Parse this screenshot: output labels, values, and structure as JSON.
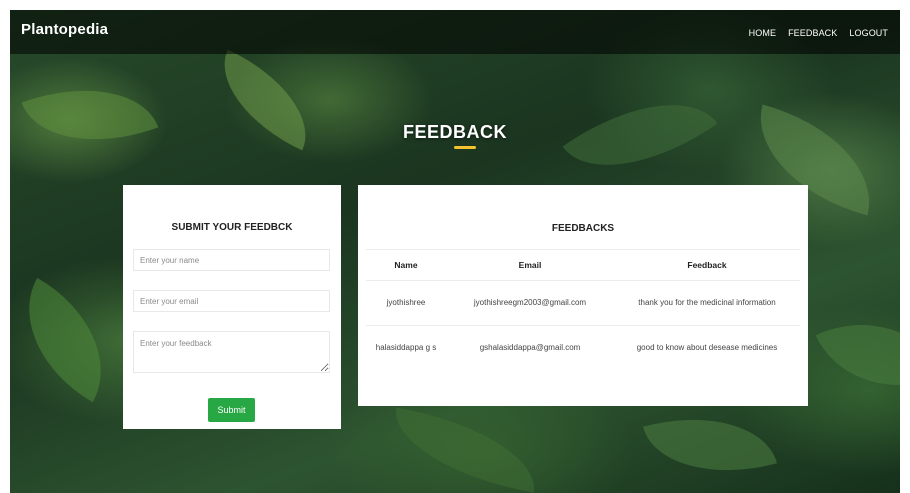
{
  "brand": "Plantopedia",
  "nav": {
    "home": "HOME",
    "feedback": "FEEDBACK",
    "logout": "LOGOUT"
  },
  "hero": {
    "title": "FEEDBACK"
  },
  "form": {
    "title": "SUBMIT YOUR FEEDBCK",
    "name_placeholder": "Enter your name",
    "email_placeholder": "Enter your email",
    "feedback_placeholder": "Enter your feedback",
    "submit_label": "Submit"
  },
  "feedbacks": {
    "title": "FEEDBACKS",
    "headers": [
      "Name",
      "Email",
      "Feedback"
    ],
    "rows": [
      {
        "name": "jyothishree",
        "email": "jyothishreegm2003@gmail.com",
        "feedback": "thank you for the medicinal information"
      },
      {
        "name": "halasiddappa g s",
        "email": "gshalasiddappa@gmail.com",
        "feedback": "good to know about desease medicines"
      }
    ]
  },
  "colors": {
    "accent_green": "#28a745",
    "underline_yellow": "#f4c430",
    "navbar": "#000000"
  }
}
